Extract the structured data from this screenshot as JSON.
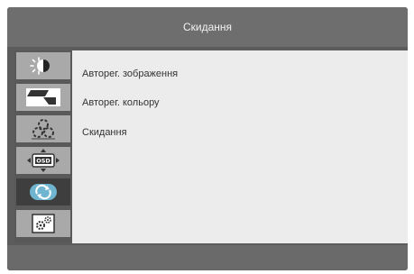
{
  "title": "Скидання",
  "sidebar": {
    "items": [
      {
        "icon": "brightness-contrast-icon"
      },
      {
        "icon": "image-adjust-icon"
      },
      {
        "icon": "color-settings-icon"
      },
      {
        "icon": "osd-settings-icon"
      },
      {
        "icon": "reset-icon",
        "active": true
      },
      {
        "icon": "system-settings-icon"
      }
    ]
  },
  "menu": {
    "items": [
      {
        "label": "Авторег. зображення"
      },
      {
        "label": "Авторег. кольору"
      },
      {
        "label": "Скидання"
      }
    ]
  },
  "colors": {
    "frame": "#5c5c5c",
    "title_bar": "#6e6e6e",
    "content_bg": "#ececec",
    "icon_tile": "#a9a9a9",
    "icon_tile_active": "#3e3e3e"
  }
}
